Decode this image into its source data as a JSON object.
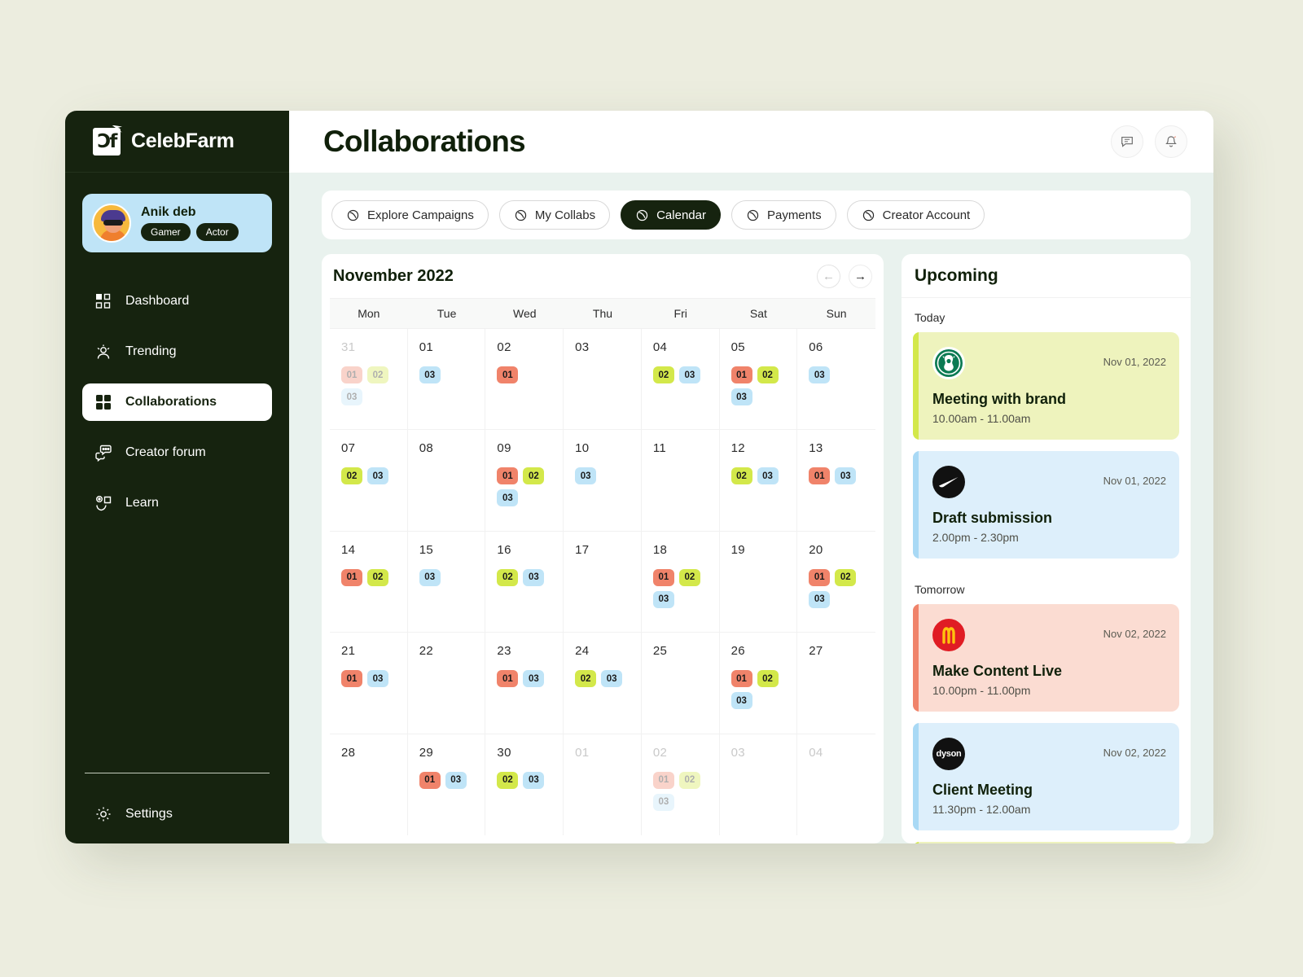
{
  "brand": {
    "name": "CelebFarm",
    "logo_glyph": "Ɔf",
    "logo_icon": "celebfarm-logo-icon"
  },
  "profile": {
    "name": "Anik deb",
    "tags": [
      "Gamer",
      "Actor"
    ],
    "avatar_icon": "avatar"
  },
  "sidebar": {
    "items": [
      {
        "label": "Dashboard",
        "icon": "dashboard-icon",
        "active": false
      },
      {
        "label": "Trending",
        "icon": "trending-icon",
        "active": false
      },
      {
        "label": "Collaborations",
        "icon": "collaborations-icon",
        "active": true
      },
      {
        "label": "Creator  forum",
        "icon": "creator-forum-icon",
        "active": false
      },
      {
        "label": "Learn",
        "icon": "learn-icon",
        "active": false
      }
    ],
    "settings": {
      "label": "Settings",
      "icon": "gear-icon"
    }
  },
  "header": {
    "title": "Collaborations",
    "actions": [
      {
        "icon": "message-icon",
        "name": "messages-button"
      },
      {
        "icon": "bell-icon",
        "name": "notifications-button"
      }
    ]
  },
  "tabs": [
    {
      "label": "Explore Campaigns",
      "icon": "circle-slash-icon",
      "active": false
    },
    {
      "label": "My Collabs",
      "icon": "circle-slash-icon",
      "active": false
    },
    {
      "label": "Calendar",
      "icon": "circle-slash-icon",
      "active": true
    },
    {
      "label": "Payments",
      "icon": "circle-slash-icon",
      "active": false
    },
    {
      "label": "Creator Account",
      "icon": "circle-slash-icon",
      "active": false
    }
  ],
  "calendar": {
    "month_label": "November 2022",
    "prev_label": "←",
    "next_label": "→",
    "weekdays": [
      "Mon",
      "Tue",
      "Wed",
      "Thu",
      "Fri",
      "Sat",
      "Sun"
    ],
    "legend_colors": {
      "01": "#f0836a",
      "02": "#d3e84a",
      "03": "#bfe4f7"
    },
    "days": [
      {
        "num": "31",
        "muted": true,
        "badges": [
          "01",
          "02",
          "03"
        ]
      },
      {
        "num": "01",
        "muted": false,
        "badges": [
          "03"
        ]
      },
      {
        "num": "02",
        "muted": false,
        "badges": [
          "01"
        ]
      },
      {
        "num": "03",
        "muted": false,
        "badges": []
      },
      {
        "num": "04",
        "muted": false,
        "badges": [
          "02",
          "03"
        ]
      },
      {
        "num": "05",
        "muted": false,
        "badges": [
          "01",
          "02",
          "03"
        ]
      },
      {
        "num": "06",
        "muted": false,
        "badges": [
          "03"
        ]
      },
      {
        "num": "07",
        "muted": false,
        "badges": [
          "02",
          "03"
        ]
      },
      {
        "num": "08",
        "muted": false,
        "badges": []
      },
      {
        "num": "09",
        "muted": false,
        "badges": [
          "01",
          "02",
          "03"
        ]
      },
      {
        "num": "10",
        "muted": false,
        "badges": [
          "03"
        ]
      },
      {
        "num": "11",
        "muted": false,
        "badges": []
      },
      {
        "num": "12",
        "muted": false,
        "badges": [
          "02",
          "03"
        ]
      },
      {
        "num": "13",
        "muted": false,
        "badges": [
          "01",
          "03"
        ]
      },
      {
        "num": "14",
        "muted": false,
        "badges": [
          "01",
          "02"
        ]
      },
      {
        "num": "15",
        "muted": false,
        "badges": [
          "03"
        ]
      },
      {
        "num": "16",
        "muted": false,
        "badges": [
          "02",
          "03"
        ]
      },
      {
        "num": "17",
        "muted": false,
        "badges": []
      },
      {
        "num": "18",
        "muted": false,
        "badges": [
          "01",
          "02",
          "03"
        ]
      },
      {
        "num": "19",
        "muted": false,
        "badges": []
      },
      {
        "num": "20",
        "muted": false,
        "badges": [
          "01",
          "02",
          "03"
        ]
      },
      {
        "num": "21",
        "muted": false,
        "badges": [
          "01",
          "03"
        ]
      },
      {
        "num": "22",
        "muted": false,
        "badges": []
      },
      {
        "num": "23",
        "muted": false,
        "badges": [
          "01",
          "03"
        ]
      },
      {
        "num": "24",
        "muted": false,
        "badges": [
          "02",
          "03"
        ]
      },
      {
        "num": "25",
        "muted": false,
        "badges": []
      },
      {
        "num": "26",
        "muted": false,
        "badges": [
          "01",
          "02",
          "03"
        ]
      },
      {
        "num": "27",
        "muted": false,
        "badges": []
      },
      {
        "num": "28",
        "muted": false,
        "badges": []
      },
      {
        "num": "29",
        "muted": false,
        "badges": [
          "01",
          "03"
        ]
      },
      {
        "num": "30",
        "muted": false,
        "badges": [
          "02",
          "03"
        ]
      },
      {
        "num": "01",
        "muted": true,
        "badges": []
      },
      {
        "num": "02",
        "muted": true,
        "badges": [
          "01",
          "02",
          "03"
        ]
      },
      {
        "num": "03",
        "muted": true,
        "badges": []
      },
      {
        "num": "04",
        "muted": true,
        "badges": []
      }
    ]
  },
  "upcoming": {
    "title": "Upcoming",
    "groups": [
      {
        "label": "Today",
        "events": [
          {
            "brand": "starbucks",
            "date": "Nov 01, 2022",
            "title": "Meeting with brand",
            "time": "10.00am - 11.00am",
            "theme": "ev-yellow"
          },
          {
            "brand": "nike",
            "date": "Nov 01, 2022",
            "title": "Draft submission",
            "time": "2.00pm - 2.30pm",
            "theme": "ev-blue"
          }
        ]
      },
      {
        "label": "Tomorrow",
        "events": [
          {
            "brand": "mcdonalds",
            "date": "Nov 02, 2022",
            "title": "Make Content Live",
            "time": "10.00pm - 11.00pm",
            "theme": "ev-red"
          },
          {
            "brand": "dyson",
            "date": "Nov 02, 2022",
            "title": "Client Meeting",
            "time": "11.30pm - 12.00am",
            "theme": "ev-blue"
          }
        ]
      }
    ]
  },
  "colors": {
    "page_bg": "#eceddf",
    "sidebar_bg": "#16230f",
    "content_bg": "#e9f2ee",
    "accent_profile": "#bfe4f7",
    "badge_01": "#f0836a",
    "badge_02": "#d3e84a",
    "badge_03": "#bfe4f7"
  }
}
